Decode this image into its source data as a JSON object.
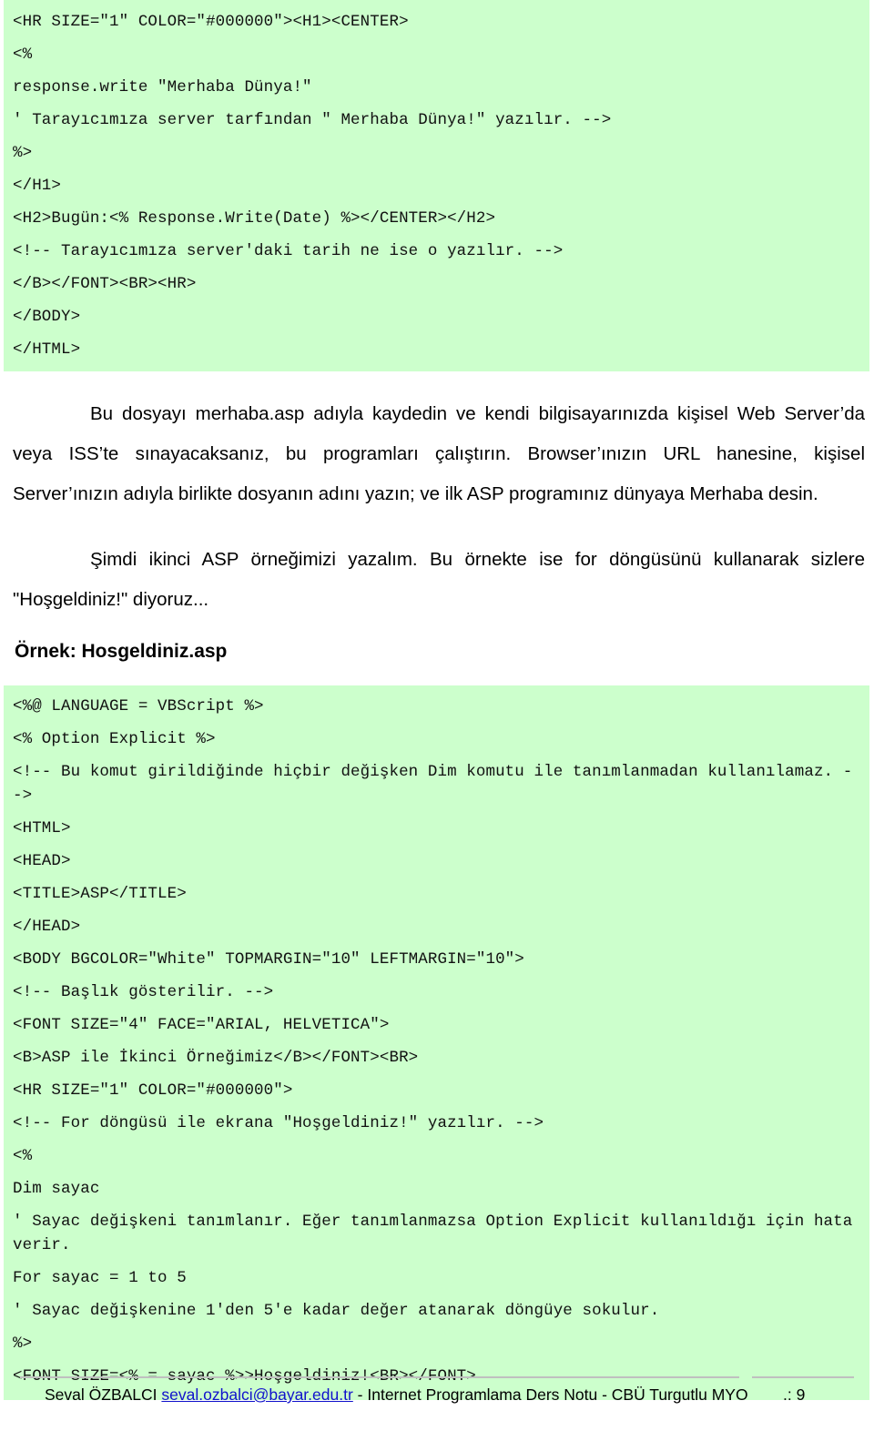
{
  "document": {
    "code_block_1": [
      "<HR SIZE=\"1\" COLOR=\"#000000\"><H1><CENTER>",
      "<%",
      "response.write \"Merhaba Dünya!\"",
      "' Tarayıcımıza server tarfından \" Merhaba Dünya!\" yazılır. -->",
      "%>",
      "</H1>",
      "<H2>Bugün:<% Response.Write(Date) %></CENTER></H2>",
      "<!-- Tarayıcımıza server'daki tarih ne ise o yazılır. -->",
      "</B></FONT><BR><HR>",
      "</BODY>",
      "</HTML>"
    ],
    "paragraph_1": "Bu dosyayı merhaba.asp adıyla kaydedin ve kendi bilgisayarınızda kişisel Web Server’da veya ISS’te sınayacaksanız, bu programları çalıştırın. Browser’ınızın URL hanesine, kişisel Server’ınızın adıyla birlikte dosyanın adını yazın; ve ilk ASP programınız dünyaya Merhaba desin.",
    "paragraph_2": "Şimdi ikinci ASP örneğimizi yazalım. Bu örnekte ise for döngüsünü kullanarak sizlere \"Hoşgeldiniz!\" diyoruz...",
    "subheading": "Örnek: Hosgeldiniz.asp",
    "code_block_2": [
      "<%@ LANGUAGE = VBScript %>",
      "<% Option Explicit %>",
      "<!-- Bu komut girildiğinde hiçbir değişken Dim komutu ile tanımlanmadan kullanılamaz. -->",
      "<HTML>",
      "<HEAD>",
      "<TITLE>ASP</TITLE>",
      "</HEAD>",
      "<BODY BGCOLOR=\"White\" TOPMARGIN=\"10\" LEFTMARGIN=\"10\">",
      "<!-- Başlık gösterilir. -->",
      "<FONT SIZE=\"4\" FACE=\"ARIAL, HELVETICA\">",
      "<B>ASP ile İkinci Örneğimiz</B></FONT><BR>",
      "<HR SIZE=\"1\" COLOR=\"#000000\">",
      "<!-- For döngüsü ile ekrana \"Hoşgeldiniz!\" yazılır. -->",
      "<%",
      "Dim sayac",
      "' Sayac değişkeni tanımlanır. Eğer tanımlanmazsa Option Explicit kullanıldığı için hata verir.",
      "For sayac = 1 to 5",
      "' Sayac değişkenine 1'den 5'e kadar değer atanarak döngüye sokulur.",
      "%>",
      "<FONT SIZE=<% = sayac %>>Hoşgeldiniz!<BR></FONT>"
    ]
  },
  "footer": {
    "author": "Seval ÖZBALCI",
    "email": "seval.ozbalci@bayar.edu.tr",
    "description": "- Internet Programlama Ders Notu - CBÜ Turgutlu MYO",
    "page_number": ".: 9"
  },
  "colors": {
    "code_background": "#ccffcc",
    "link": "#1111cc",
    "rule": "#bfbfbf",
    "text": "#000000"
  }
}
